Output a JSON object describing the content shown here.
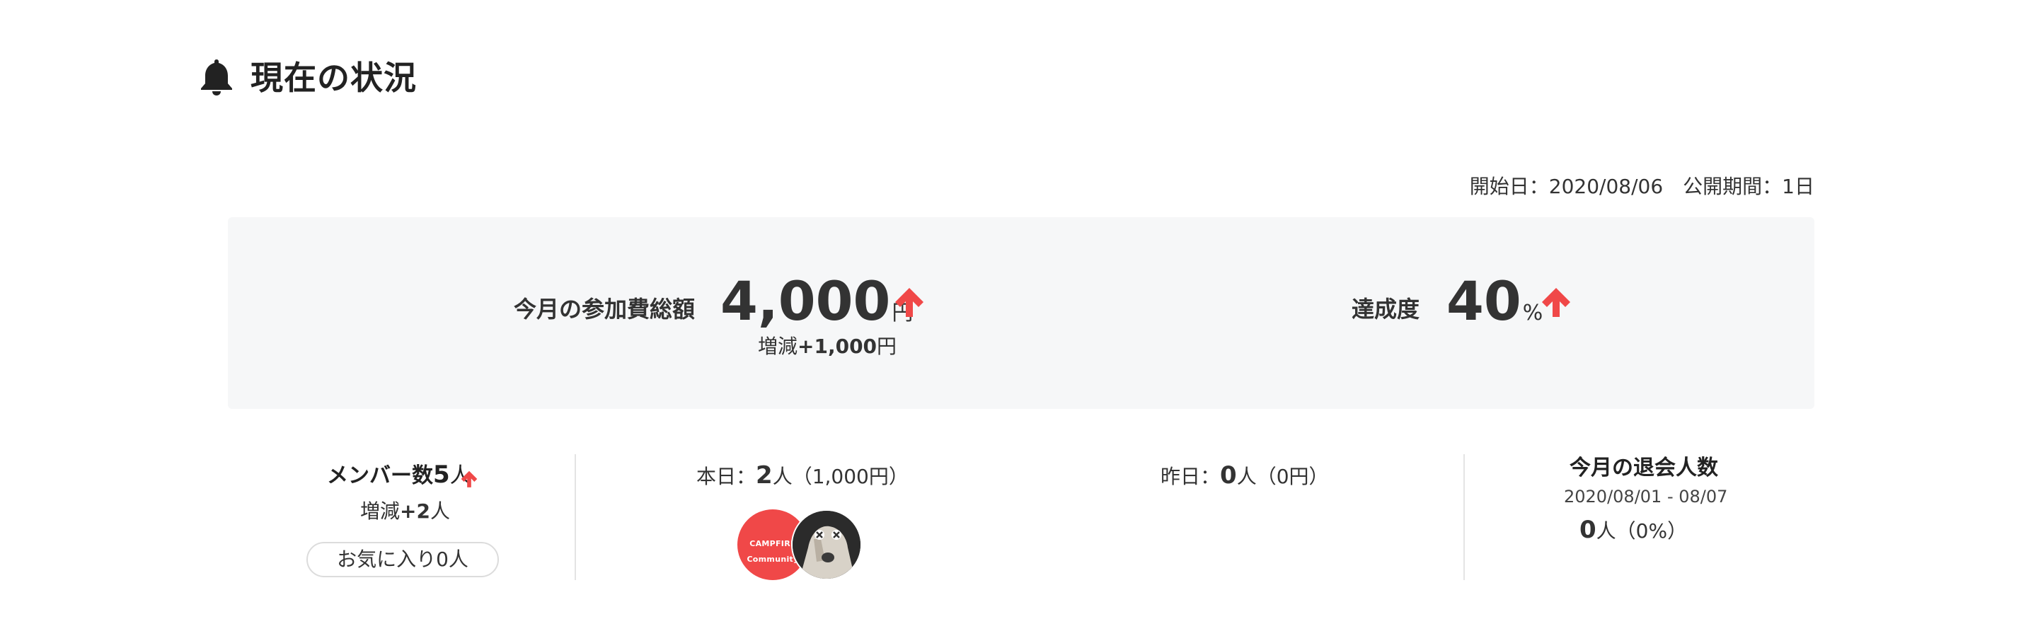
{
  "header": {
    "title": "現在の状況",
    "icon": "bell-icon"
  },
  "meta": {
    "start": "開始日：2020/08/06",
    "period": "公開期間：1日"
  },
  "summary": {
    "total_label": "今月の参加費総額",
    "total_amount": "4,000",
    "total_unit": "円",
    "total_diff_prefix": "増減",
    "total_diff_value": "+1,000",
    "total_diff_unit": "円",
    "rate_label": "達成度",
    "rate_value": "40",
    "rate_unit": "%"
  },
  "members": {
    "label": "メンバー数",
    "count": "5",
    "unit": "人",
    "diff_prefix": "増減",
    "diff_value": "+2",
    "diff_unit": "人",
    "favorite": "お気に入り0人"
  },
  "today": {
    "label": "本日：",
    "count": "2",
    "rest": "人（1,000円）",
    "avatar_brand": "CAMPFIRE Community"
  },
  "yesterday": {
    "label": "昨日：",
    "count": "0",
    "rest": "人（0円）"
  },
  "leave": {
    "title": "今月の退会人数",
    "range": "2020/08/01 - 08/07",
    "count": "0",
    "rest": "人（0%）"
  },
  "colors": {
    "accent_arrow": "#f04848",
    "panel_bg": "#f6f7f8",
    "text": "#333333"
  }
}
